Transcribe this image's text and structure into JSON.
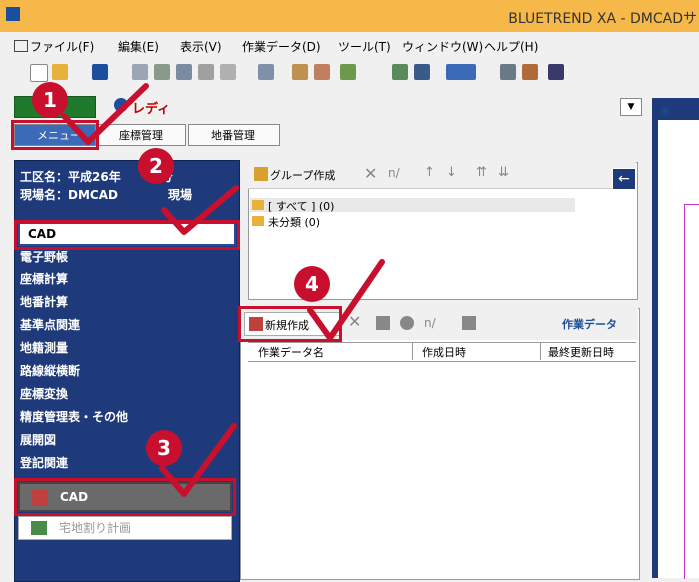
{
  "window": {
    "title": "BLUETREND XA - DMCADサ"
  },
  "menubar": {
    "items": [
      "ファイル(F)",
      "編集(E)",
      "表示(V)",
      "作業データ(D)",
      "ツール(T)",
      "ウィンドウ(W)",
      "ヘルプ(H)"
    ]
  },
  "status": {
    "text": "レディ"
  },
  "tabs": [
    "メニュー",
    "座標管理",
    "地番管理"
  ],
  "project": {
    "line1": "工区名：平成26年",
    "line1_tail": "分",
    "line2": "現場名：DMCAD",
    "line2_tail": "現場"
  },
  "left_panel": {
    "selected_input": "CAD",
    "items": [
      "電子野帳",
      "座標計算",
      "地番計算",
      "基準点関連",
      "地籍測量",
      "路線縦横断",
      "座標変換",
      "精度管理表・その他",
      "展開図",
      "登記関連"
    ],
    "cad_button": "CAD",
    "takuchi": "宅地割り計画"
  },
  "group_panel": {
    "toolbar_label": "グループ作成",
    "tree": [
      "[ すべて ] (0)",
      "未分類 (0)"
    ]
  },
  "data_panel": {
    "new_button": "新規作成",
    "title": "作業データ",
    "columns": [
      "作業データ名",
      "作成日時",
      "最終更新日時"
    ]
  },
  "markers": [
    "1",
    "2",
    "3",
    "4"
  ],
  "colors": {
    "accent_red": "#c8102e",
    "panel_blue": "#1f3a7a",
    "titlebar": "#f7b84a"
  }
}
